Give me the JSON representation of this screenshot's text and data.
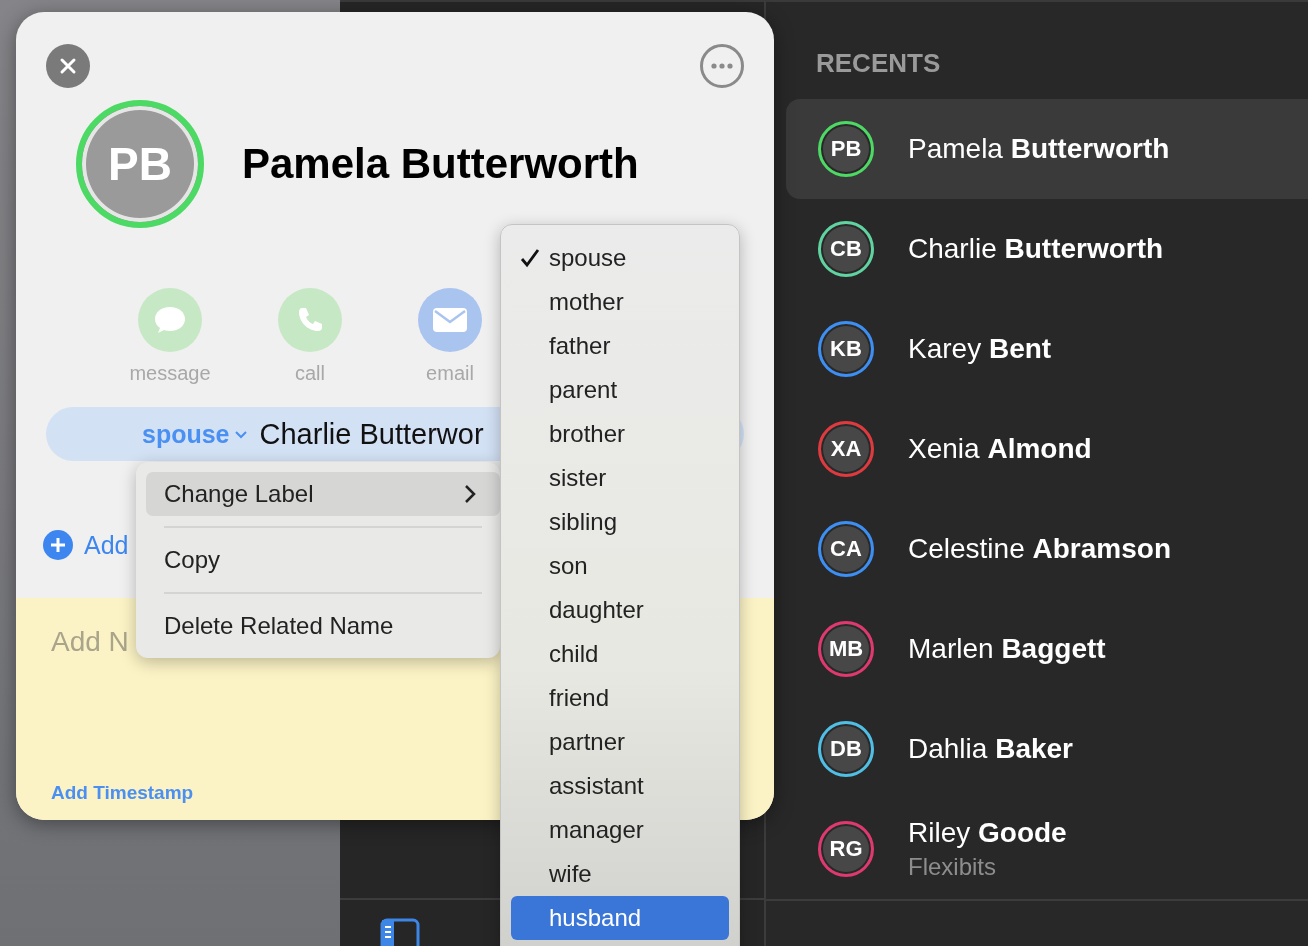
{
  "card": {
    "initials": "PB",
    "name": "Pamela Butterworth",
    "actions": [
      {
        "kind": "message",
        "label": "message"
      },
      {
        "kind": "call",
        "label": "call"
      },
      {
        "kind": "email",
        "label": "email"
      }
    ],
    "related": {
      "label": "spouse",
      "value": "Charlie Butterwor"
    },
    "add_label": "Add",
    "notes_placeholder": "Add N",
    "timestamp_link": "Add Timestamp"
  },
  "context_menu": {
    "items": [
      {
        "label": "Change Label",
        "kind": "submenu",
        "selected": true
      },
      {
        "label": "Copy",
        "kind": "item",
        "selected": false
      },
      {
        "label": "Delete Related Name",
        "kind": "item",
        "selected": false
      }
    ]
  },
  "label_menu": {
    "items": [
      {
        "label": "spouse",
        "checked": true,
        "selected": false
      },
      {
        "label": "mother",
        "checked": false,
        "selected": false
      },
      {
        "label": "father",
        "checked": false,
        "selected": false
      },
      {
        "label": "parent",
        "checked": false,
        "selected": false
      },
      {
        "label": "brother",
        "checked": false,
        "selected": false
      },
      {
        "label": "sister",
        "checked": false,
        "selected": false
      },
      {
        "label": "sibling",
        "checked": false,
        "selected": false
      },
      {
        "label": "son",
        "checked": false,
        "selected": false
      },
      {
        "label": "daughter",
        "checked": false,
        "selected": false
      },
      {
        "label": "child",
        "checked": false,
        "selected": false
      },
      {
        "label": "friend",
        "checked": false,
        "selected": false
      },
      {
        "label": "partner",
        "checked": false,
        "selected": false
      },
      {
        "label": "assistant",
        "checked": false,
        "selected": false
      },
      {
        "label": "manager",
        "checked": false,
        "selected": false
      },
      {
        "label": "wife",
        "checked": false,
        "selected": false
      },
      {
        "label": "husband",
        "checked": false,
        "selected": true
      }
    ]
  },
  "recents": {
    "title": "RECENTS",
    "contacts": [
      {
        "initials": "PB",
        "name": "Pamela **Butterworth**",
        "color": "#4cd964",
        "selected": true
      },
      {
        "initials": "CB",
        "name": "Charlie **Butterworth**",
        "color": "#5fd3a0",
        "selected": false
      },
      {
        "initials": "KB",
        "name": "Karey **Bent**",
        "color": "#3b8ff5",
        "selected": false
      },
      {
        "initials": "XA",
        "name": "Xenia **Almond**",
        "color": "#e0393e",
        "selected": false
      },
      {
        "initials": "CA",
        "name": "Celestine **Abramson**",
        "color": "#3b8ff5",
        "selected": false
      },
      {
        "initials": "MB",
        "name": "Marlen **Baggett**",
        "color": "#e0386f",
        "selected": false
      },
      {
        "initials": "DB",
        "name": "Dahlia **Baker**",
        "color": "#4fbfe6",
        "selected": false
      },
      {
        "initials": "RG",
        "name": "Riley **Goode**",
        "subtitle": "Flexibits",
        "color": "#e0386f",
        "selected": false
      }
    ]
  }
}
